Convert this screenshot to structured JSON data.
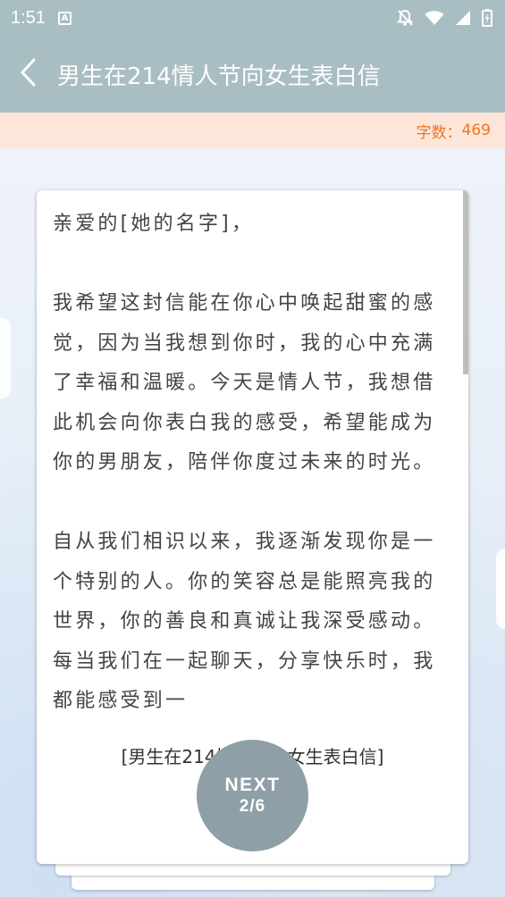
{
  "status_bar": {
    "time": "1:51",
    "notification_icon": "A",
    "icons": [
      "notifications-off-icon",
      "wifi-icon",
      "signal-icon",
      "battery-icon"
    ]
  },
  "app_bar": {
    "back_icon": "chevron-left-icon",
    "title": "男生在214情人节向女生表白信"
  },
  "word_count": {
    "label": "字数：",
    "value": "469"
  },
  "letter": {
    "greeting": "亲爱的[她的名字]，",
    "paragraphs": [
      "我希望这封信能在你心中唤起甜蜜的感觉，因为当我想到你时，我的心中充满了幸福和温暖。今天是情人节，我想借此机会向你表白我的感受，希望能成为你的男朋友，陪伴你度过未来的时光。",
      "自从我们相识以来，我逐渐发现你是一个特别的人。你的笑容总是能照亮我的世界，你的善良和真诚让我深受感动。每当我们在一起聊天，分享快乐时，我都能感受到一"
    ],
    "caption": "[男生在214情人节向女生表白信]"
  },
  "next_button": {
    "label": "NEXT",
    "page": "2/6"
  },
  "colors": {
    "app_bar": "#a9bec2",
    "count_strip": "#fde6d9",
    "count_text": "#f0741f",
    "next_button": "#8f9fa7"
  }
}
